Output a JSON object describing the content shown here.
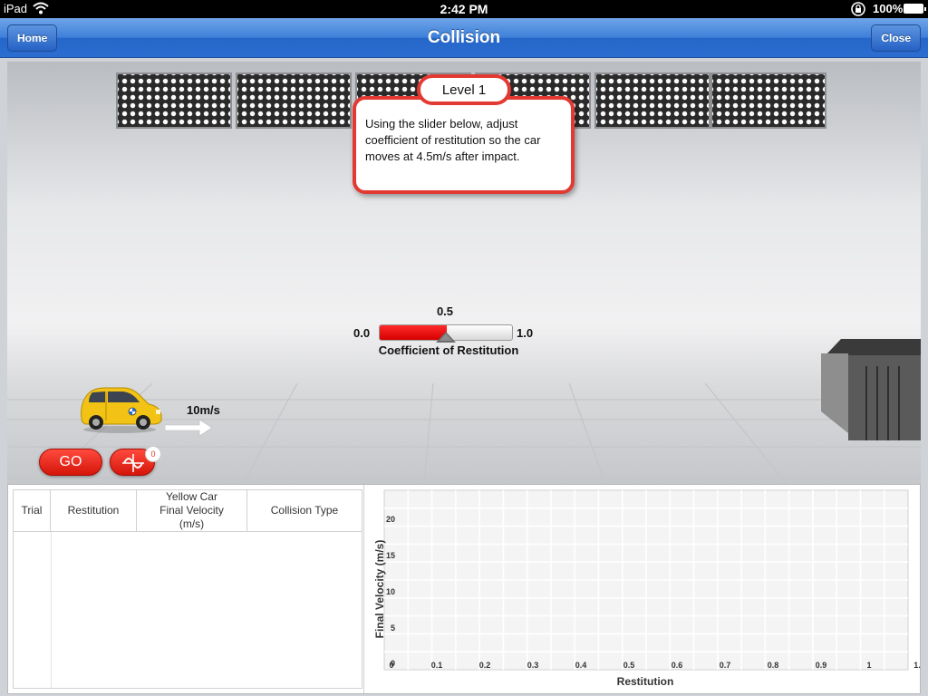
{
  "status_bar": {
    "device": "iPad",
    "time": "2:42 PM",
    "battery": "100%"
  },
  "navbar": {
    "title": "Collision",
    "home_label": "Home",
    "close_label": "Close"
  },
  "callout": {
    "level": "Level 1",
    "text": "Using the slider below, adjust coefficient of restitution so the car moves at 4.5m/s after impact."
  },
  "slider": {
    "value": "0.5",
    "min": "0.0",
    "max": "1.0",
    "label": "Coefficient of Restitution",
    "fraction": 0.5
  },
  "car": {
    "speed": "10m/s",
    "color": "#f2c314"
  },
  "controls": {
    "go_label": "GO",
    "badge": "0"
  },
  "table": {
    "headers": [
      "Trial",
      "Restitution",
      "Yellow Car Final Velocity (m/s)",
      "Collision Type"
    ],
    "rows": []
  },
  "graph": {
    "ylabel": "Final Velocity (m/s)",
    "xlabel": "Restitution",
    "yticks": [
      "20",
      "15",
      "10",
      "5",
      "0"
    ],
    "xticks": [
      "0",
      "0.1",
      "0.2",
      "0.3",
      "0.4",
      "0.5",
      "0.6",
      "0.7",
      "0.8",
      "0.9",
      "1",
      "1."
    ]
  },
  "colors": {
    "accent_red": "#e23a32",
    "nav_blue": "#2b6dd0"
  }
}
